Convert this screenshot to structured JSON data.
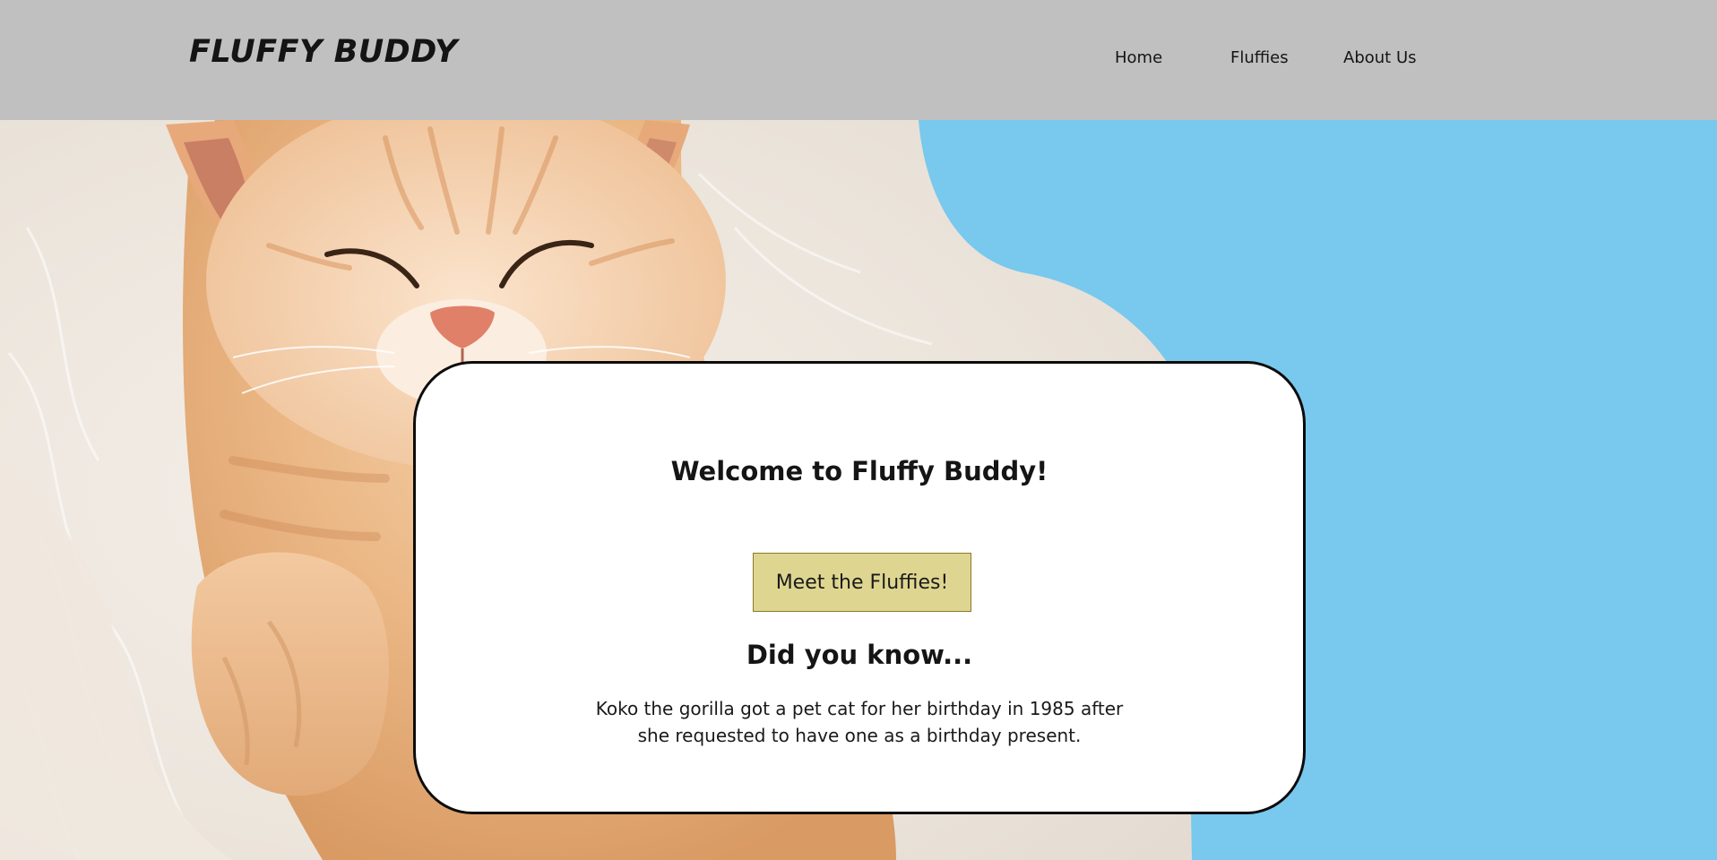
{
  "header": {
    "logo": "FLUFFY BUDDY",
    "nav": [
      "Home",
      "Fluffies",
      "About Us"
    ]
  },
  "hero": {
    "image_subject": "sleeping orange kitten on white fur",
    "background_color": "#79c8ee"
  },
  "card": {
    "title": "Welcome to Fluffy Buddy!",
    "button_label": "Meet the Fluffies!",
    "fact_title": "Did you know...",
    "fact_text": "Koko the gorilla got a pet cat for her birthday in 1985 after she requested to have one as a birthday present."
  },
  "colors": {
    "header_bg": "#c0c0c0",
    "accent_blue": "#79c8ee",
    "button_bg": "#ded690"
  }
}
